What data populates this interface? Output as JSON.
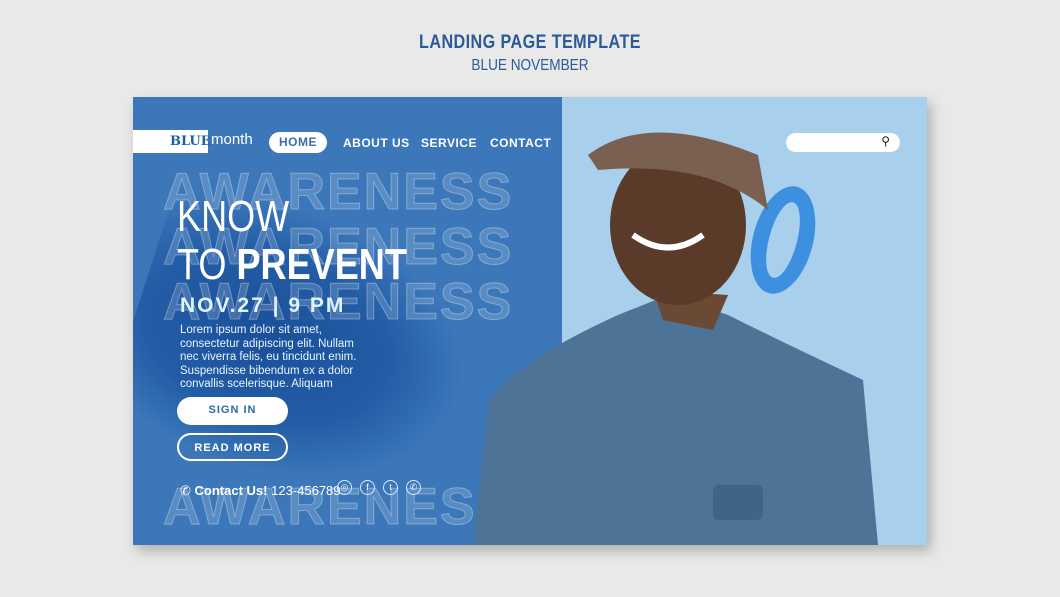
{
  "header": {
    "title": "LANDING PAGE TEMPLATE",
    "subtitle": "BLUE NOVEMBER"
  },
  "logo": {
    "bold": "BLUE",
    "light": "month"
  },
  "nav": [
    "HOME",
    "ABOUT US",
    "SERVICE",
    "CONTACT"
  ],
  "hero": {
    "line1": "KNOW",
    "line2a": "TO",
    "line2b": "PREVENT",
    "date": "NOV.27 | 9 PM",
    "body": "Lorem ipsum dolor sit amet, consectetur adipiscing elit. Nullam nec viverra felis, eu tincidunt enim. Suspendisse bibendum ex a dolor convallis scelerisque. Aliquam",
    "watermark": "AWARENESS"
  },
  "buttons": {
    "sign_in": "SIGN IN",
    "read_more": "READ MORE"
  },
  "contact": {
    "label": "Contact Us!",
    "phone": "123-456789"
  },
  "social": [
    "instagram",
    "facebook",
    "twitter",
    "whatsapp"
  ],
  "colors": {
    "primary": "#3b77b9",
    "light": "#a8cfeb",
    "ribbon": "#3d8fe0"
  }
}
